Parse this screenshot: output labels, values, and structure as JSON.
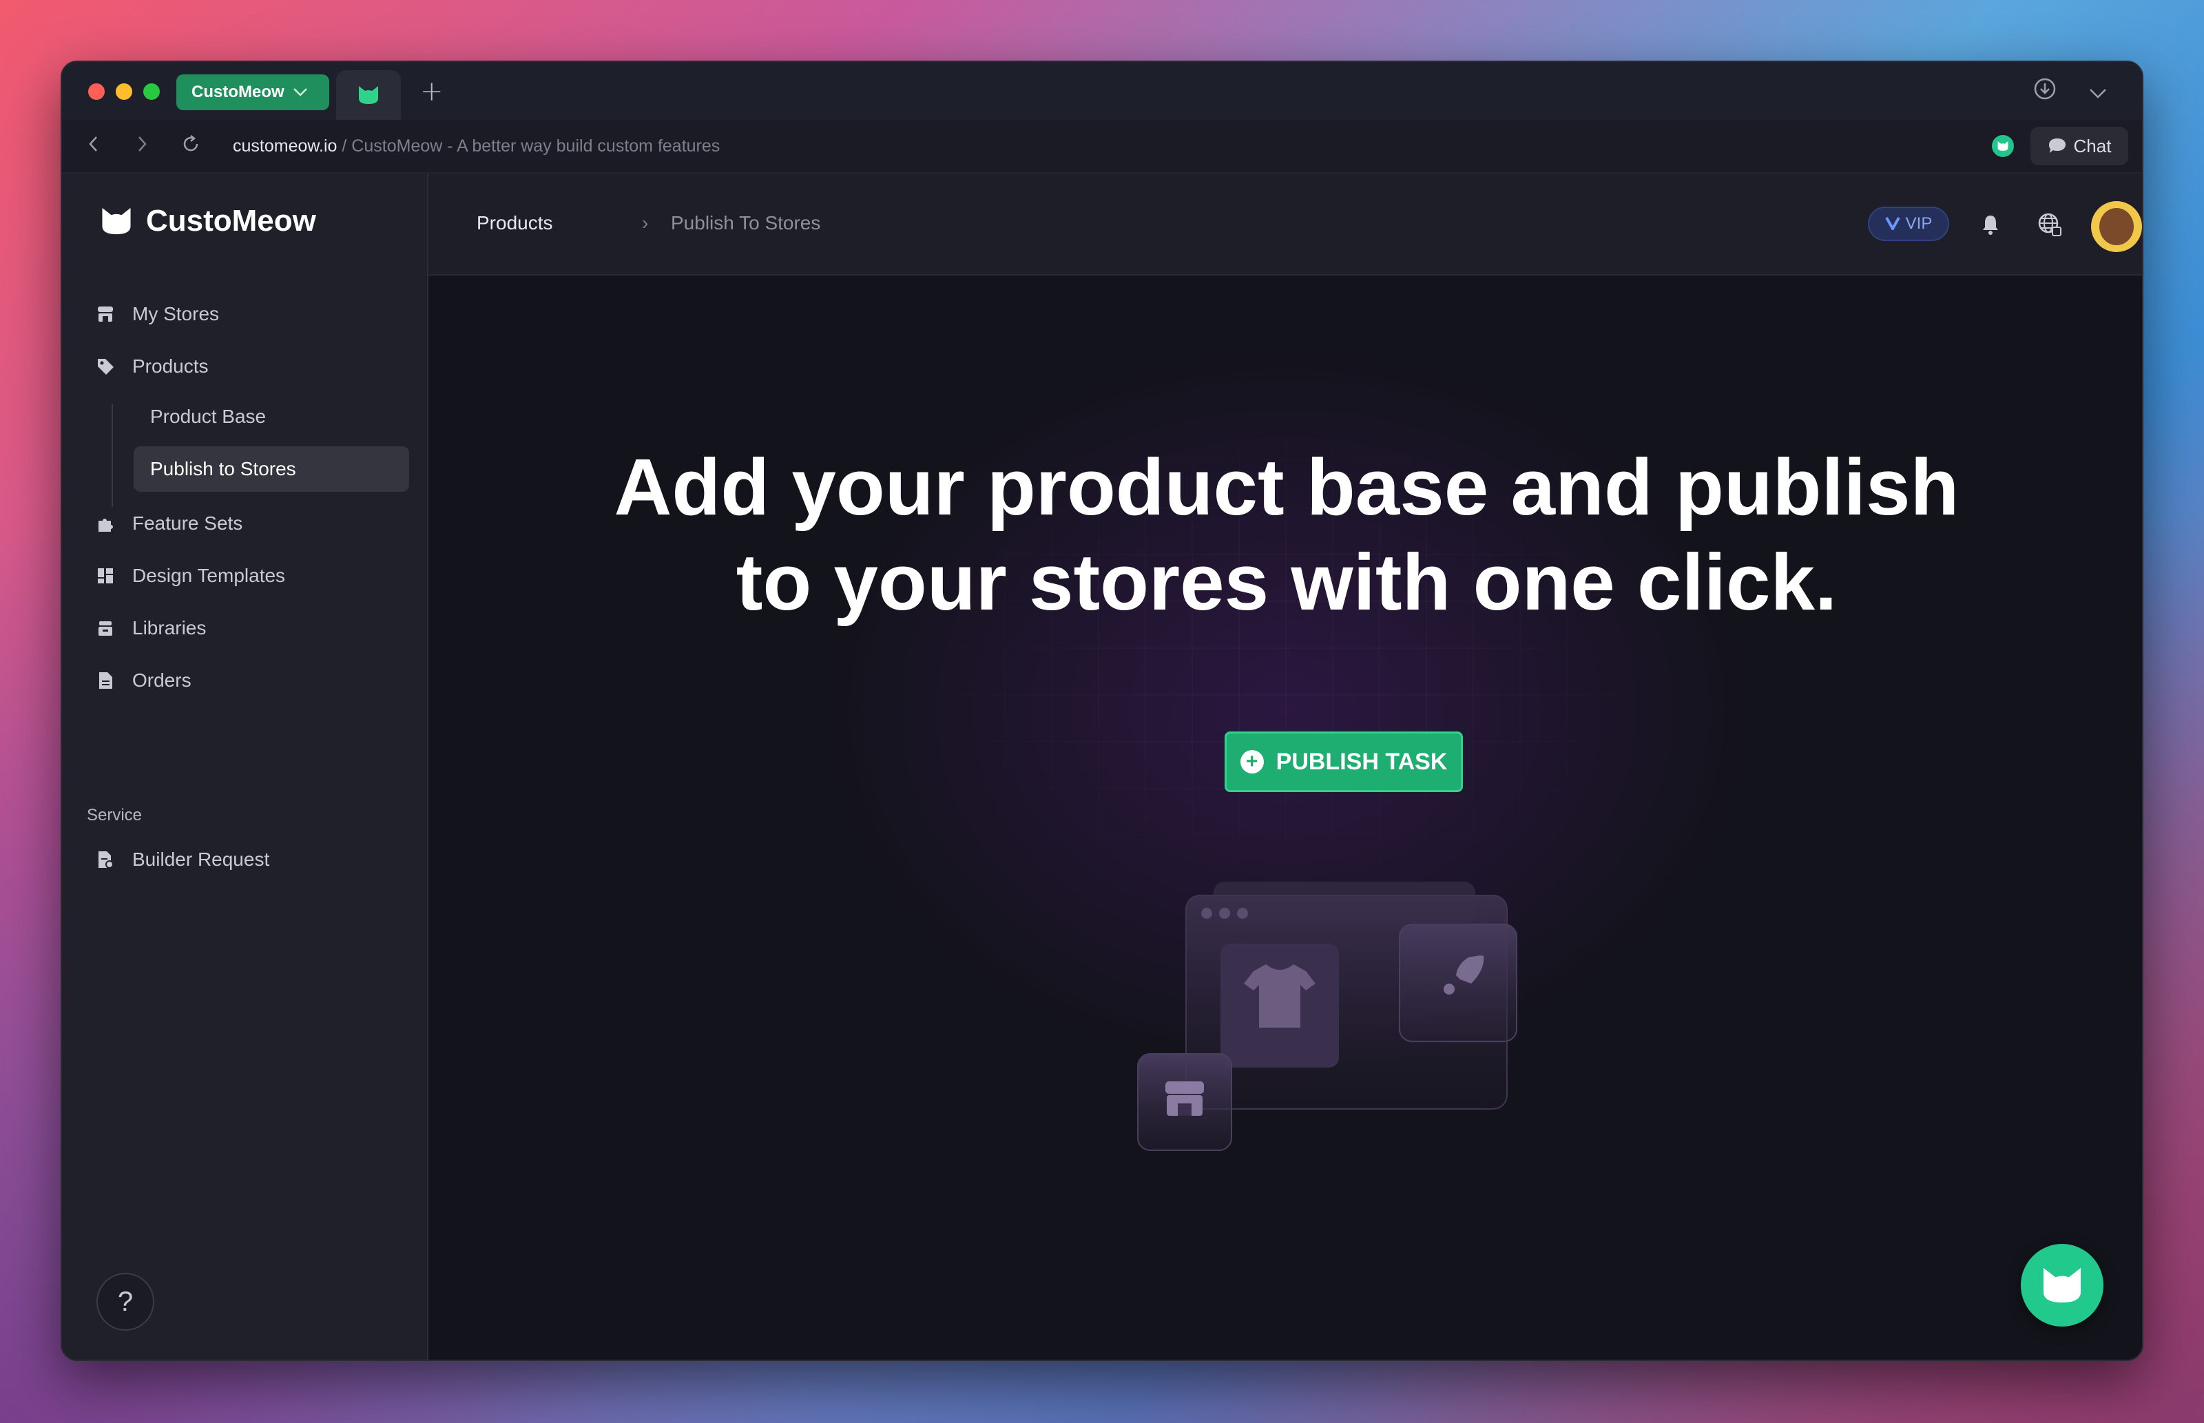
{
  "browser": {
    "active_tab_label": "CustoMeow",
    "url_domain": "customeow.io",
    "url_rest": " / CustoMeow - A better way build custom features",
    "chat_label": "Chat"
  },
  "sidebar": {
    "brand": "CustoMeow",
    "items": [
      {
        "label": "My Stores",
        "icon": "store-icon"
      },
      {
        "label": "Products",
        "icon": "tag-icon"
      },
      {
        "label": "Feature Sets",
        "icon": "puzzle-icon"
      },
      {
        "label": "Design Templates",
        "icon": "grid-icon"
      },
      {
        "label": "Libraries",
        "icon": "archive-icon"
      },
      {
        "label": "Orders",
        "icon": "document-icon"
      }
    ],
    "sub_items": [
      {
        "label": "Product Base"
      },
      {
        "label": "Publish to Stores",
        "active": true
      }
    ],
    "section_label": "Service",
    "service_items": [
      {
        "label": "Builder Request",
        "icon": "request-icon"
      }
    ],
    "help_label": "?"
  },
  "header": {
    "breadcrumb_root": "Products",
    "breadcrumb_separator": "›",
    "breadcrumb_current": "Publish To Stores",
    "vip_label": "VIP"
  },
  "main": {
    "headline_line1": "Add your product base and publish",
    "headline_line2": "to your stores with one click.",
    "publish_button_label": "PUBLISH TASK"
  },
  "colors": {
    "accent_green": "#1fae72",
    "vip_blue": "#6f95ff",
    "background": "#13131b"
  }
}
